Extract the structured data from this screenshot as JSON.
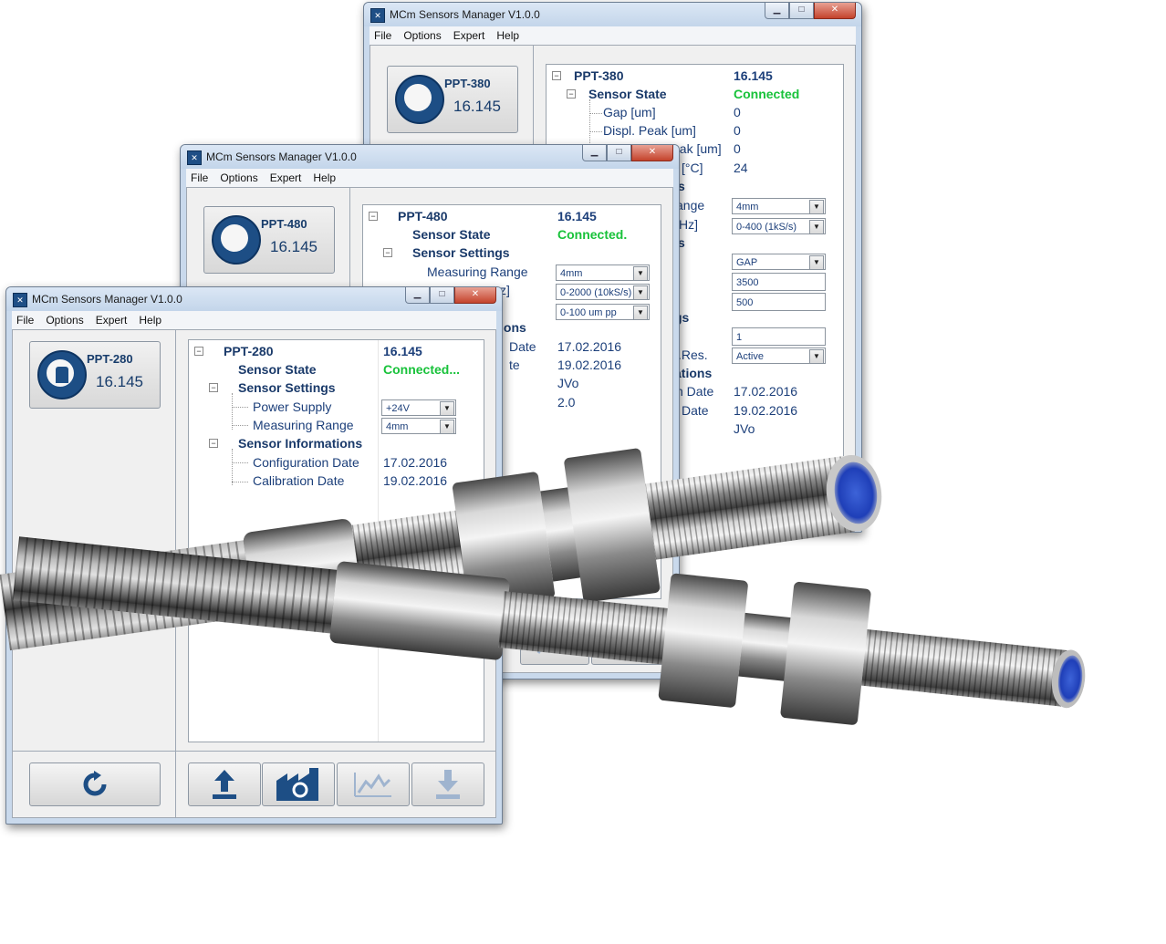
{
  "windows": {
    "w380": {
      "title": "MCm Sensors Manager V1.0.0",
      "menu": [
        "File",
        "Options",
        "Expert",
        "Help"
      ],
      "sensor_name": "PPT-380",
      "sensor_version": "16.145",
      "tree_root": "PPT-380",
      "tree_root_value": "16.145",
      "sensor_state_label": "Sensor State",
      "sensor_state_value": "Connected",
      "rows": [
        "Gap [um]",
        "Displ. Peak [um]",
        "eak [um]",
        "[°C]",
        "s",
        "ange",
        "Hz]",
        "s",
        "gs",
        ".Res.",
        "ations",
        "n Date",
        "Date"
      ],
      "values": [
        "0",
        "0",
        "0",
        "24"
      ],
      "combo_range": "4mm",
      "combo_rate": "0-400 (1kS/s)",
      "combo_mode": "GAP",
      "text_1": "3500",
      "text_2": "500",
      "text_3": "1",
      "combo_active": "Active",
      "date_config": "17.02.2016",
      "date_calib": "19.02.2016",
      "author": "JVo"
    },
    "w480": {
      "title": "MCm Sensors Manager V1.0.0",
      "menu": [
        "File",
        "Options",
        "Expert",
        "Help"
      ],
      "sensor_name": "PPT-480",
      "sensor_version": "16.145",
      "tree_root": "PPT-480",
      "tree_root_value": "16.145",
      "sensor_state_label": "Sensor State",
      "sensor_state_value": "Connected.",
      "sensor_settings_label": "Sensor Settings",
      "measuring_range_label": "Measuring Range",
      "partial_rate_label": "z]",
      "partial_info_label": "ions",
      "partial_config_label": "Date",
      "partial_calib_label": "te",
      "combo_range": "4mm",
      "combo_rate": "0-2000 (10kS/s)",
      "combo_pp": "0-100 um pp",
      "date_config": "17.02.2016",
      "date_calib": "19.02.2016",
      "author": "JVo",
      "version_value": "2.0"
    },
    "w280": {
      "title": "MCm Sensors Manager V1.0.0",
      "menu": [
        "File",
        "Options",
        "Expert",
        "Help"
      ],
      "sensor_name": "PPT-280",
      "sensor_version": "16.145",
      "tree_root": "PPT-280",
      "tree_root_value": "16.145",
      "sensor_state_label": "Sensor State",
      "sensor_state_value": "Connected...",
      "sensor_settings_label": "Sensor Settings",
      "power_supply_label": "Power Supply",
      "measuring_range_label": "Measuring Range",
      "sensor_info_label": "Sensor Informations",
      "config_date_label": "Configuration Date",
      "calib_date_label": "Calibration Date",
      "combo_power": "+24V",
      "combo_range": "4mm",
      "date_config": "17.02.2016",
      "date_calib": "19.02.2016"
    }
  },
  "colors": {
    "connected": "#18c23a",
    "brand_blue": "#1d4e85"
  }
}
